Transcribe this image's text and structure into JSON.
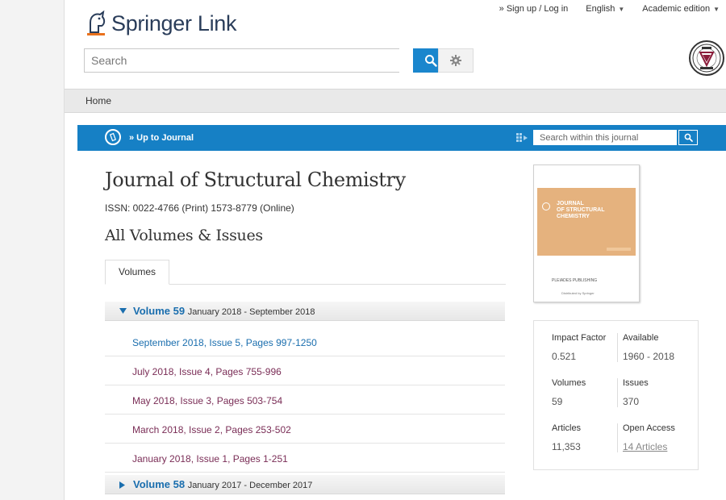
{
  "brand": {
    "name_a": "Springer",
    "name_b": "Link"
  },
  "topnav": {
    "signup": "» Sign up / Log in",
    "language": "English",
    "edition": "Academic edition"
  },
  "search": {
    "placeholder": "Search"
  },
  "breadcrumb": {
    "home": "Home"
  },
  "journalbar": {
    "up_label": "» Up to Journal",
    "search_placeholder": "Search within this journal"
  },
  "journal": {
    "title": "Journal of Structural Chemistry",
    "issn": "ISSN: 0022-4766 (Print) 1573-8779 (Online)",
    "section_title": "All Volumes & Issues"
  },
  "tabs": [
    "Volumes"
  ],
  "volumes": [
    {
      "name": "Volume 59",
      "range": "January 2018 - September 2018",
      "expanded": true
    },
    {
      "name": "Volume 58",
      "range": "January 2017 - December 2017",
      "expanded": false
    }
  ],
  "issues": [
    "September 2018, Issue 5, Pages 997-1250",
    "July 2018, Issue 4, Pages 755-996",
    "May 2018, Issue 3, Pages 503-754",
    "March 2018, Issue 2, Pages 253-502",
    "January 2018, Issue 1, Pages 1-251"
  ],
  "cover": {
    "title_line1": "JOURNAL",
    "title_line2": "OF STRUCTURAL",
    "title_line3": "CHEMISTRY",
    "publisher": "PLEIADES PUBLISHING",
    "distributed": "Distributed by Springer"
  },
  "metrics": {
    "impact_factor_label": "Impact Factor",
    "impact_factor": "0.521",
    "available_label": "Available",
    "available": "1960 - 2018",
    "volumes_label": "Volumes",
    "volumes": "59",
    "issues_label": "Issues",
    "issues": "370",
    "articles_label": "Articles",
    "articles": "11,353",
    "open_access_label": "Open Access",
    "open_access": "14 Articles"
  },
  "colors": {
    "accent": "#1680c5",
    "issue_link": "#7a2d56",
    "volume_link": "#1a6eae",
    "cover_band": "#e5b27e"
  }
}
